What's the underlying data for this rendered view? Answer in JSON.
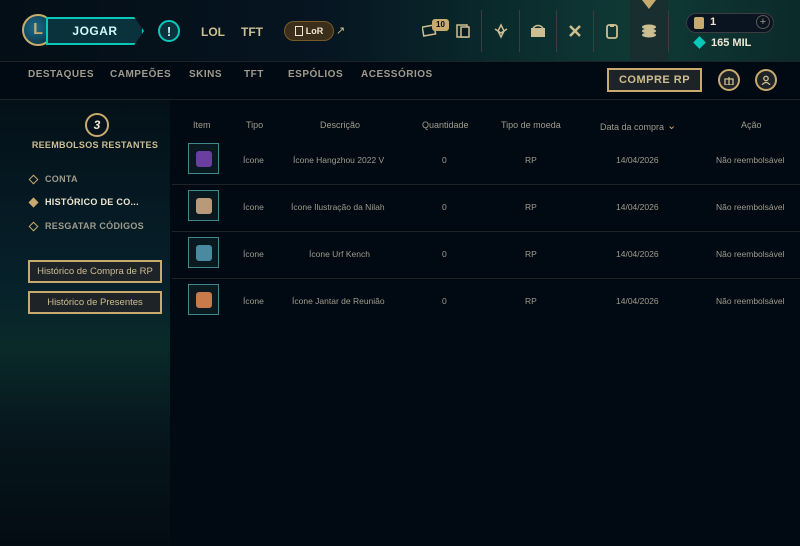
{
  "topbar": {
    "play_label": "JOGAR",
    "alert_label": "!",
    "tabs": [
      "LOL",
      "TFT"
    ],
    "lor_label": "LoR",
    "lor_arrow": "↗",
    "loot_badge": "10",
    "wallet": {
      "rp": "1",
      "plus": "+",
      "be": "165 MIL"
    }
  },
  "subnav": {
    "items": [
      "DESTAQUES",
      "CAMPEÕES",
      "SKINS",
      "TFT",
      "ESPÓLIOS",
      "ACESSÓRIOS"
    ],
    "buy_rp": "COMPRE RP"
  },
  "sidebar": {
    "refund_count": "3",
    "refund_label": "REEMBOLSOS RESTANTES",
    "items": [
      {
        "label": "CONTA",
        "active": false
      },
      {
        "label": "HISTÓRICO DE CO...",
        "active": true
      },
      {
        "label": "RESGATAR CÓDIGOS",
        "active": false
      }
    ],
    "buttons": [
      "Histórico de Compra de RP",
      "Histórico de Presentes"
    ]
  },
  "table": {
    "headers": [
      "Item",
      "Tipo",
      "Descrição",
      "Quantidade",
      "Tipo de moeda",
      "Data da compra",
      "Ação"
    ],
    "sort_indicator": "⌄",
    "rows": [
      {
        "tipo": "Ícone",
        "descricao": "Ícone Hangzhou 2022 V",
        "quantidade": "0",
        "moeda": "RP",
        "data": "14/04/2026",
        "acao": "Não reembolsável",
        "color": "#6a3fa0"
      },
      {
        "tipo": "Ícone",
        "descricao": "Ícone Ilustração da Nilah",
        "quantidade": "0",
        "moeda": "RP",
        "data": "14/04/2026",
        "acao": "Não reembolsável",
        "color": "#b89a7a"
      },
      {
        "tipo": "Ícone",
        "descricao": "Ícone Urf Kench",
        "quantidade": "0",
        "moeda": "RP",
        "data": "14/04/2026",
        "acao": "Não reembolsável",
        "color": "#4a8aa0"
      },
      {
        "tipo": "Ícone",
        "descricao": "Ícone Jantar de Reunião",
        "quantidade": "0",
        "moeda": "RP",
        "data": "14/04/2026",
        "acao": "Não reembolsável",
        "color": "#c87a4a"
      }
    ]
  },
  "colors": {
    "gold": "#c8aa6e",
    "teal": "#0ac8b9",
    "bg": "#010a13"
  }
}
